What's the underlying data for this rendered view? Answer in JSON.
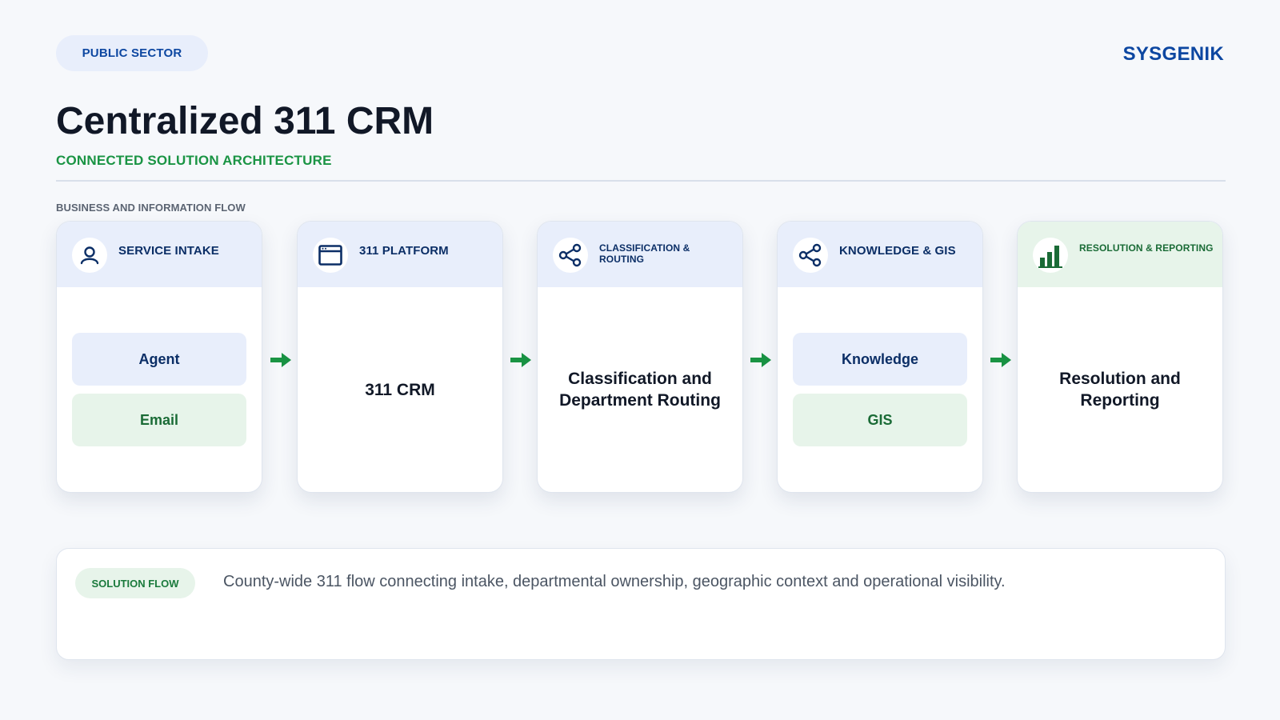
{
  "header": {
    "sector_label": "PUBLIC SECTOR",
    "brand": "SYSGENIK",
    "title": "Centralized 311 CRM",
    "subtitle": "CONNECTED SOLUTION ARCHITECTURE"
  },
  "section_label": "BUSINESS AND INFORMATION FLOW",
  "stages": [
    {
      "title": "SERVICE INTAKE",
      "icon": "user-icon",
      "items": [
        "Agent",
        "Email"
      ]
    },
    {
      "title": "311 PLATFORM",
      "icon": "browser-window-icon",
      "center": "311 CRM"
    },
    {
      "title": "CLASSIFICATION & ROUTING",
      "icon": "share-nodes-icon",
      "center": "Classification and Department Routing"
    },
    {
      "title": "KNOWLEDGE & GIS",
      "icon": "share-nodes-icon",
      "items": [
        "Knowledge",
        "GIS"
      ]
    },
    {
      "title": "RESOLUTION & REPORTING",
      "icon": "bar-chart-icon",
      "center": "Resolution and Reporting"
    }
  ],
  "footer": {
    "flow_label": "SOLUTION FLOW",
    "flow_text": "County-wide 311 flow connecting intake, departmental ownership, geographic context and operational visibility."
  },
  "colors": {
    "primary_blue": "#0d47a1",
    "accent_green": "#1a9444",
    "arrow_green": "#1a9444",
    "blue_tint": "#e8eefb",
    "green_tint": "#e7f4ea"
  }
}
